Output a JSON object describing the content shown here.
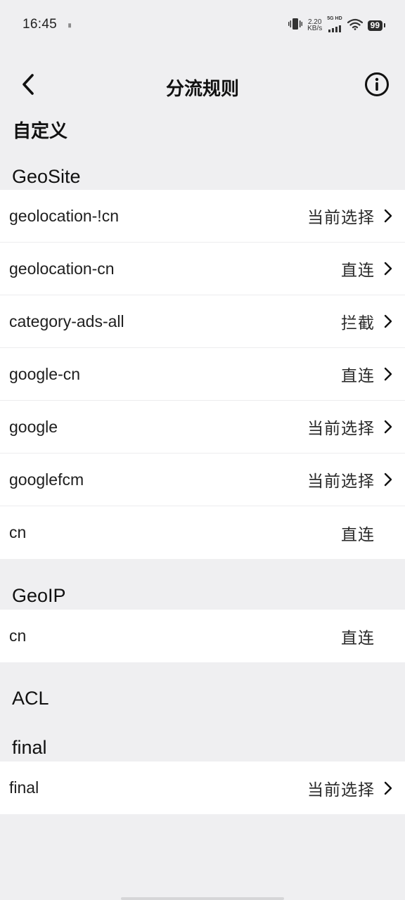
{
  "status_bar": {
    "time": "16:45",
    "pause_glyph": "॥",
    "net_speed_value": "2.20",
    "net_speed_unit": "KB/s",
    "network_label": "5G HD",
    "battery_level": "99",
    "icons": [
      "vibrate-icon",
      "signal-icon",
      "wifi-icon",
      "battery-icon"
    ]
  },
  "appbar": {
    "title": "分流规则",
    "back_icon": "chevron-left-icon",
    "info_icon": "info-circle-icon"
  },
  "sections": {
    "custom": {
      "title": "自定义"
    },
    "geosite": {
      "title": "GeoSite",
      "rows": [
        {
          "label": "geolocation-!cn",
          "value": "当前选择",
          "chevron": true
        },
        {
          "label": "geolocation-cn",
          "value": "直连",
          "chevron": true
        },
        {
          "label": "category-ads-all",
          "value": "拦截",
          "chevron": true
        },
        {
          "label": "google-cn",
          "value": "直连",
          "chevron": true
        },
        {
          "label": "google",
          "value": "当前选择",
          "chevron": true
        },
        {
          "label": "googlefcm",
          "value": "当前选择",
          "chevron": true
        },
        {
          "label": "cn",
          "value": "直连",
          "chevron": false
        }
      ]
    },
    "geoip": {
      "title": "GeoIP",
      "rows": [
        {
          "label": "cn",
          "value": "直连",
          "chevron": false
        }
      ]
    },
    "acl": {
      "title": "ACL"
    },
    "final": {
      "title": "final",
      "rows": [
        {
          "label": "final",
          "value": "当前选择",
          "chevron": true
        }
      ]
    }
  },
  "colors": {
    "background": "#efeff1",
    "card": "#ffffff",
    "text": "#1a1a1a",
    "divider": "#ececee"
  }
}
